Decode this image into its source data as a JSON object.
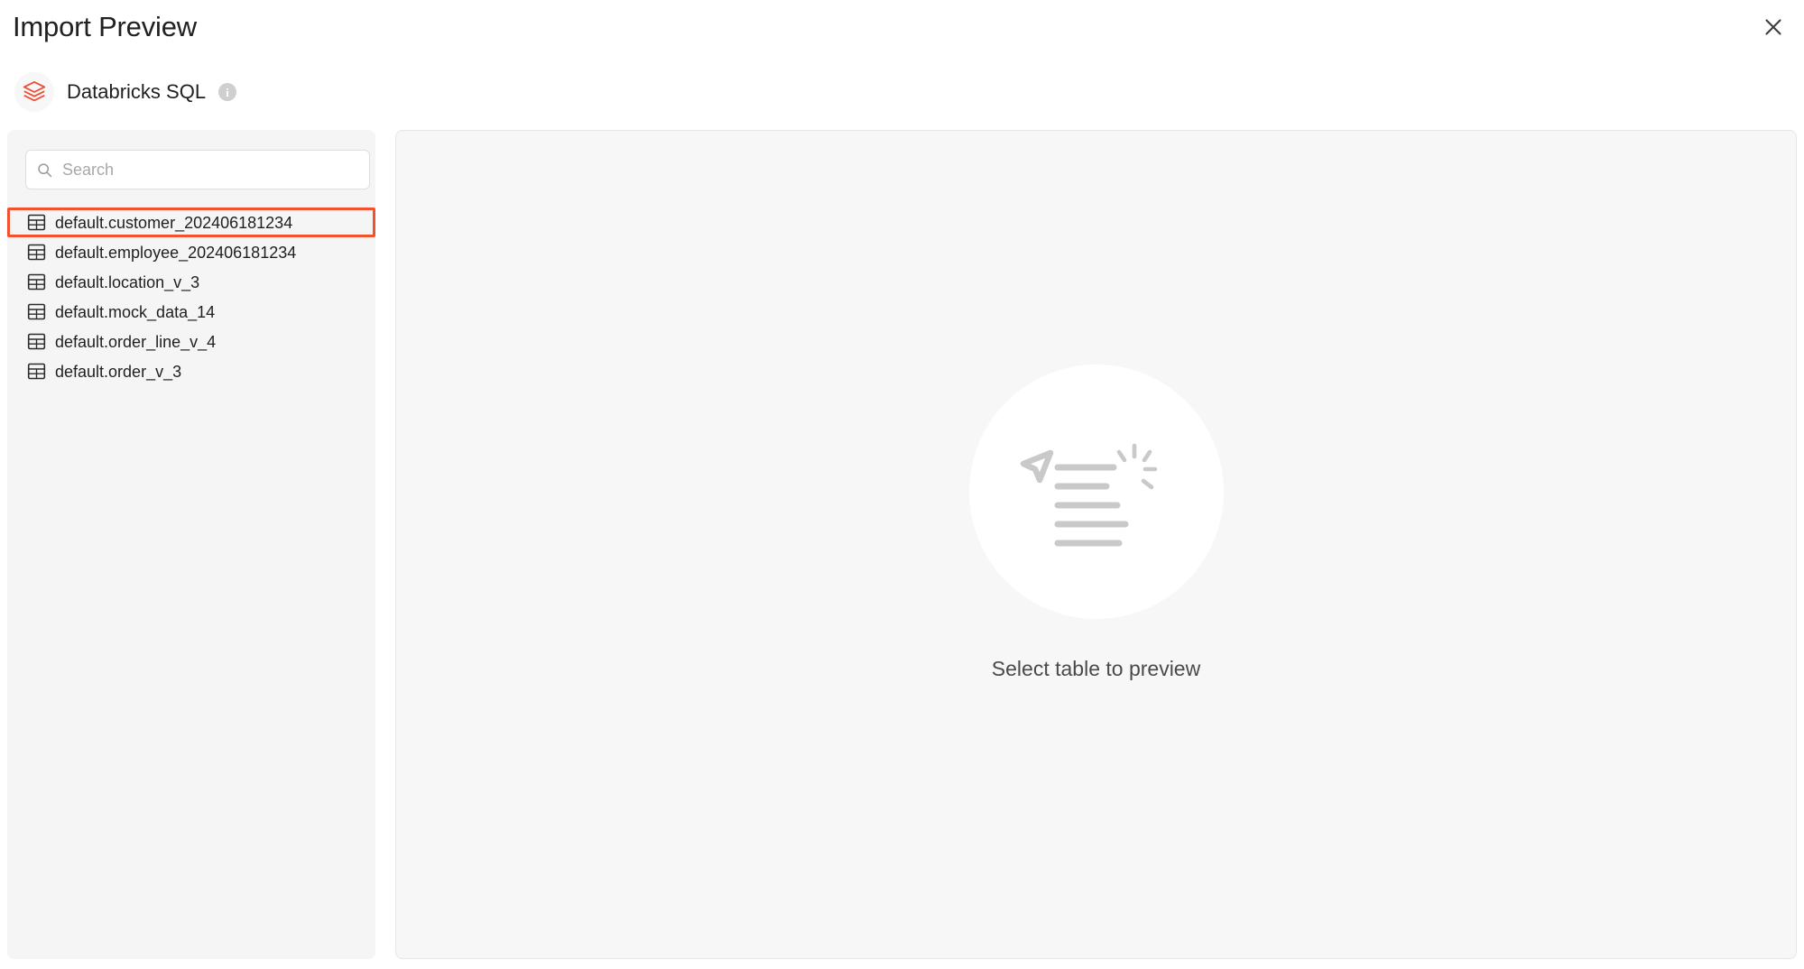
{
  "window": {
    "title": "Import Preview",
    "close_icon": "close-icon"
  },
  "source": {
    "logo_icon": "databricks-logo-icon",
    "name": "Databricks SQL",
    "info_icon": "info-icon",
    "info_glyph": "i",
    "brand_color": "#f2522e"
  },
  "sidebar": {
    "search": {
      "icon": "search-icon",
      "value": "",
      "placeholder": "Search"
    },
    "tables": [
      {
        "name": "default.customer_202406181234",
        "icon": "table-icon",
        "selected": true
      },
      {
        "name": "default.employee_202406181234",
        "icon": "table-icon",
        "selected": false
      },
      {
        "name": "default.location_v_3",
        "icon": "table-icon",
        "selected": false
      },
      {
        "name": "default.mock_data_14",
        "icon": "table-icon",
        "selected": false
      },
      {
        "name": "default.order_line_v_4",
        "icon": "table-icon",
        "selected": false
      },
      {
        "name": "default.order_v_3",
        "icon": "table-icon",
        "selected": false
      }
    ],
    "selection_highlight_color": "#f2522e"
  },
  "preview": {
    "empty_state": {
      "illustration_icon": "cursor-select-lines-icon",
      "message": "Select table to preview"
    }
  }
}
